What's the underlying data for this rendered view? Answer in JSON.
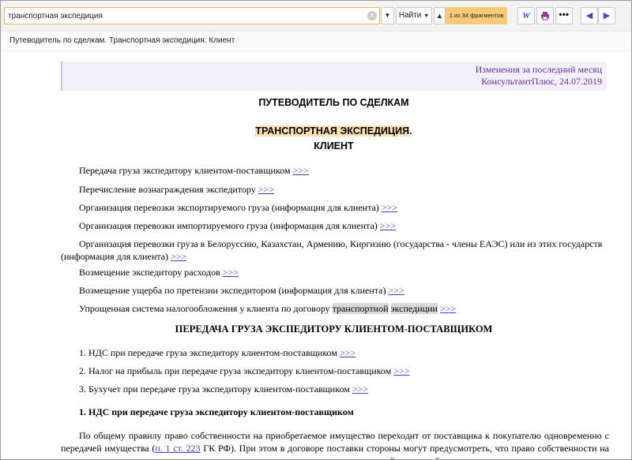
{
  "toolbar": {
    "search_value": "транспортная экспедиция",
    "clear_icon": "clear-icon",
    "find_label": "Найти",
    "match_counter": "1 из 34 фрагментов",
    "icons": {
      "history": "chevron-down-icon",
      "prev_match": "arrow-up-icon",
      "word": "word-export-icon",
      "print": "print-icon",
      "more": "more-icon",
      "back": "arrow-left-icon",
      "forward": "arrow-right-icon"
    }
  },
  "breadcrumb": "Путеводитель по сделкам. Транспортная экспедиция. Клиент",
  "document": {
    "info": {
      "changes_link": "Изменения",
      "changes_suffix": "за последний месяц",
      "date": "КонсультантПлюс, 24.07.2019"
    },
    "title": "ПУТЕВОДИТЕЛЬ ПО СДЕЛКАМ",
    "subtitle_highlighted": "ТРАНСПОРТНАЯ ЭКСПЕДИЦИЯ",
    "subtitle_dot": ".",
    "subtitle_client": "КЛИЕНТ",
    "link_arrow": ">>>",
    "toc": [
      "Передача груза экспедитору клиентом-поставщиком",
      "Перечисление вознаграждения экспедитору",
      "Организация перевозки экспортируемого груза (информация для клиента)",
      "Организация перевозки импортируемого груза (информация для клиента)",
      "Организация перевозки груза в Белоруссию, Казахстан, Армению, Киргизию (государства - члены ЕАЭС) или из этих государств (информация для клиента)",
      "Возмещение экспедитору расходов",
      "Возмещение ущерба по претензии экспедитором (информация для клиента)"
    ],
    "toc_last_prefix": "Упрощенная система налогообложения у клиента по договору",
    "toc_last_hl1": "транспортной",
    "toc_last_hl2": "экспедиции",
    "section_heading": "ПЕРЕДАЧА ГРУЗА ЭКСПЕДИТОРУ КЛИЕНТОМ-ПОСТАВЩИКОМ",
    "section_items": [
      "1. НДС при передаче груза экспедитору клиентом-поставщиком",
      "2. Налог на прибыль при передаче груза экспедитору клиентом-поставщиком",
      "3. Бухучет при передаче груза экспедитору клиентом-поставщиком"
    ],
    "subsection_heading": "1. НДС при передаче груза экспедитору клиентом-поставщиком",
    "para1_start": "По общему правилу право собственности на приобретаемое имущество переходит от поставщика к покупателю одновременно с передачей имущества (",
    "para1_link": "п. 1 ст. 223",
    "para1_end": " ГК РФ). При этом в договоре поставки стороны могут предусмотреть, что право собственности на имущество переходит к покупателю на дату подписания им товарно-транспортной накладной, что не противоречит нормам"
  }
}
